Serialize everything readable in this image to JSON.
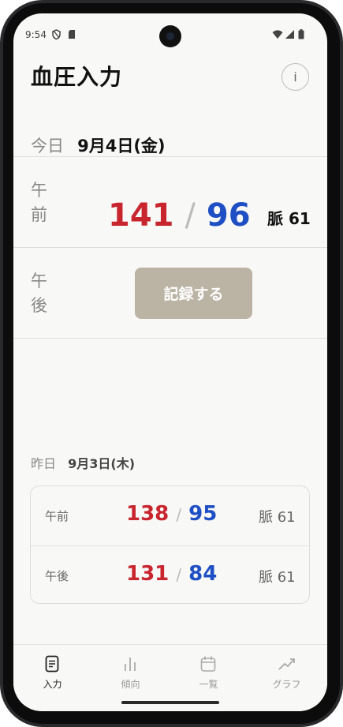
{
  "status_bar": {
    "time": "9:54"
  },
  "app": {
    "title": "血圧入力",
    "info_label": "i"
  },
  "today": {
    "label": "今日",
    "date": "9月4日(金)",
    "am": {
      "label_line1": "午",
      "label_line2": "前",
      "systolic": "141",
      "slash": "/",
      "diastolic": "96",
      "pulse": "脈 61"
    },
    "pm": {
      "label_line1": "午",
      "label_line2": "後",
      "record_label": "記録する"
    }
  },
  "yesterday": {
    "label": "昨日",
    "date": "9月3日(木)",
    "rows": [
      {
        "period": "午前",
        "systolic": "138",
        "slash": "/",
        "diastolic": "95",
        "pulse": "脈 61"
      },
      {
        "period": "午後",
        "systolic": "131",
        "slash": "/",
        "diastolic": "84",
        "pulse": "脈 61"
      }
    ]
  },
  "tabs": [
    {
      "label": "入力",
      "icon": "document-icon",
      "active": true
    },
    {
      "label": "傾向",
      "icon": "bar-chart-icon",
      "active": false
    },
    {
      "label": "一覧",
      "icon": "calendar-icon",
      "active": false
    },
    {
      "label": "グラフ",
      "icon": "line-chart-icon",
      "active": false
    }
  ],
  "colors": {
    "systolic": "#c8252e",
    "diastolic": "#1f4fc4",
    "record_button": "#bbb3a4"
  }
}
